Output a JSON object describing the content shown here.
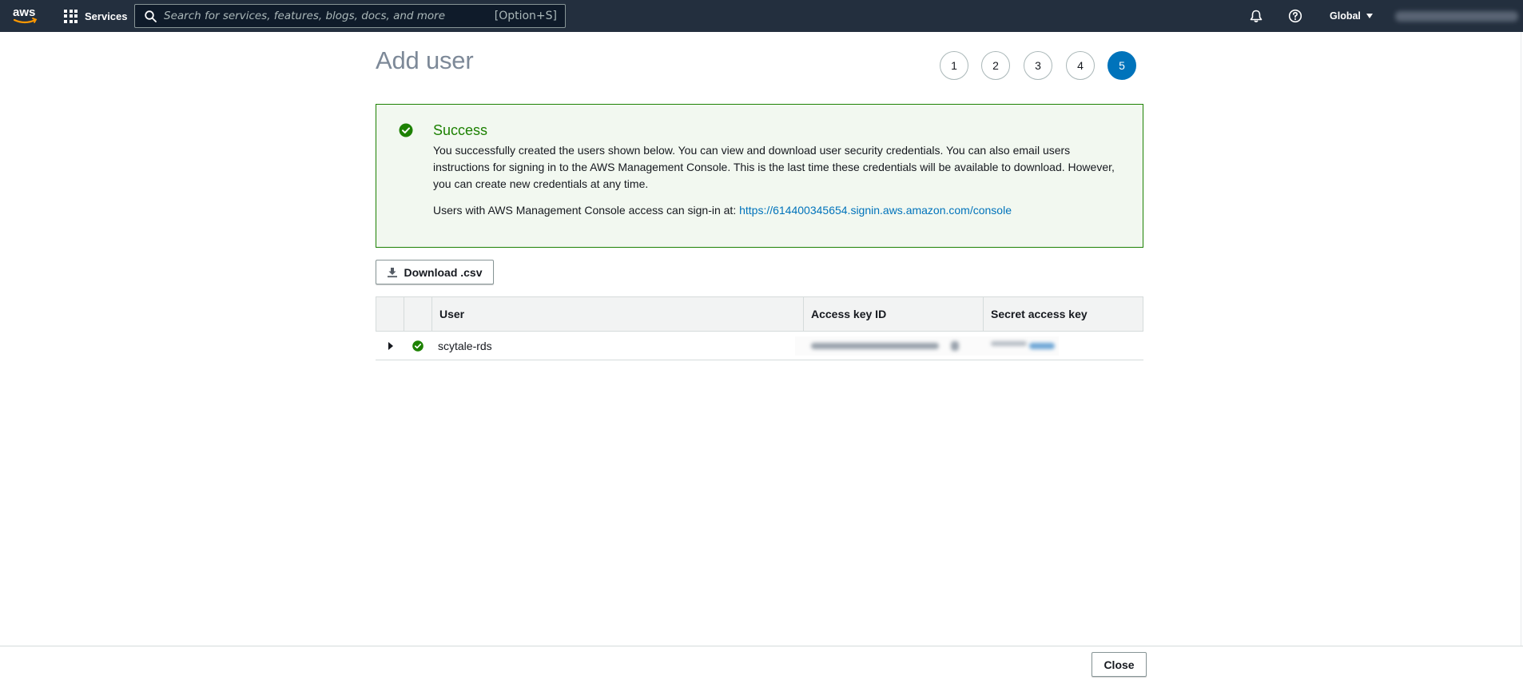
{
  "header": {
    "services_label": "Services",
    "search_placeholder": "Search for services, features, blogs, docs, and more",
    "search_shortcut": "[Option+S]",
    "region_label": "Global",
    "icons": [
      "aws-logo",
      "grid-icon",
      "search-icon",
      "bell-icon",
      "help-icon",
      "chevron-down-icon"
    ]
  },
  "page": {
    "title": "Add user",
    "steps": [
      {
        "label": "1",
        "active": false
      },
      {
        "label": "2",
        "active": false
      },
      {
        "label": "3",
        "active": false
      },
      {
        "label": "4",
        "active": false
      },
      {
        "label": "5",
        "active": true
      }
    ]
  },
  "alert": {
    "title": "Success",
    "body": "You successfully created the users shown below. You can view and download user security credentials. You can also email users instructions for signing in to the AWS Management Console. This is the last time these credentials will be available to download. However, you can create new credentials at any time.",
    "signin_prefix": "Users with AWS Management Console access can sign-in at:",
    "signin_link": "https://614400345654.signin.aws.amazon.com/console"
  },
  "download_button": "Download .csv",
  "table": {
    "headers": [
      "",
      "",
      "User",
      "Access key ID",
      "Secret access key"
    ],
    "rows": [
      {
        "user": "scytale-rds",
        "status": "success"
      }
    ]
  },
  "footer": {
    "close_label": "Close"
  },
  "colors": {
    "nav_bg": "#232f3e",
    "success": "#1d8102",
    "link": "#0073bb",
    "active_step": "#0073bb"
  }
}
